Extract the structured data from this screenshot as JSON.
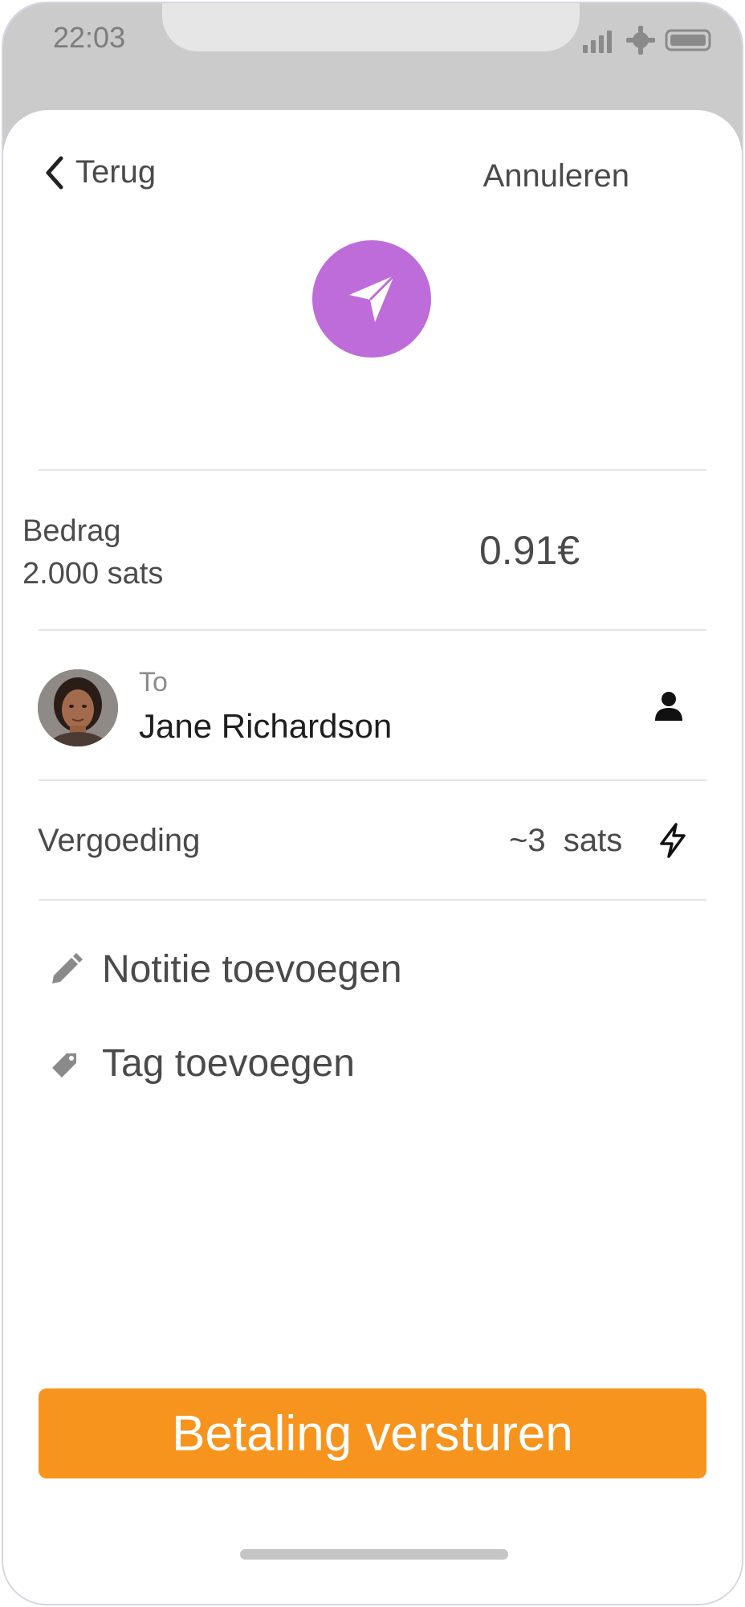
{
  "status_bar": {
    "time": "22:03"
  },
  "nav": {
    "back_label": "Terug",
    "cancel_label": "Annuleren"
  },
  "amount": {
    "title": "Bedrag",
    "sats": "2.000 sats",
    "fiat": "0.91€"
  },
  "recipient": {
    "to_label": "To",
    "name": "Jane Richardson"
  },
  "fee": {
    "label": "Vergoeding",
    "value": "~3  sats"
  },
  "actions": {
    "note_label": "Notitie toevoegen",
    "tag_label": "Tag toevoegen"
  },
  "primary_button": {
    "label": "Betaling versturen"
  },
  "colors": {
    "accent_purple": "#bd6cd9",
    "button_orange": "#f7941d"
  },
  "icons": [
    "send-icon",
    "chevron-left-icon",
    "person-icon",
    "lightning-icon",
    "pencil-icon",
    "tag-icon"
  ]
}
